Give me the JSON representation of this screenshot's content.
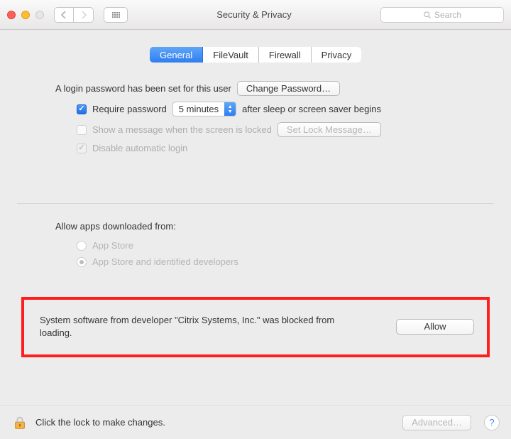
{
  "window": {
    "title": "Security & Privacy",
    "search_placeholder": "Search"
  },
  "tabs": {
    "general": "General",
    "filevault": "FileVault",
    "firewall": "Firewall",
    "privacy": "Privacy"
  },
  "login_section": {
    "label": "A login password has been set for this user",
    "change_password_btn": "Change Password…",
    "require_password_label": "Require password",
    "delay_value": "5 minutes",
    "after_sleep_label": "after sleep or screen saver begins",
    "show_message_label": "Show a message when the screen is locked",
    "set_lock_message_btn": "Set Lock Message…",
    "disable_auto_login_label": "Disable automatic login"
  },
  "allow_apps_section": {
    "heading": "Allow apps downloaded from:",
    "option_appstore": "App Store",
    "option_appstore_identified": "App Store and identified developers"
  },
  "blocked": {
    "message": "System software from developer \"Citrix Systems, Inc.\" was blocked from loading.",
    "allow_btn": "Allow"
  },
  "footer": {
    "lock_text": "Click the lock to make changes.",
    "advanced_btn": "Advanced…"
  }
}
